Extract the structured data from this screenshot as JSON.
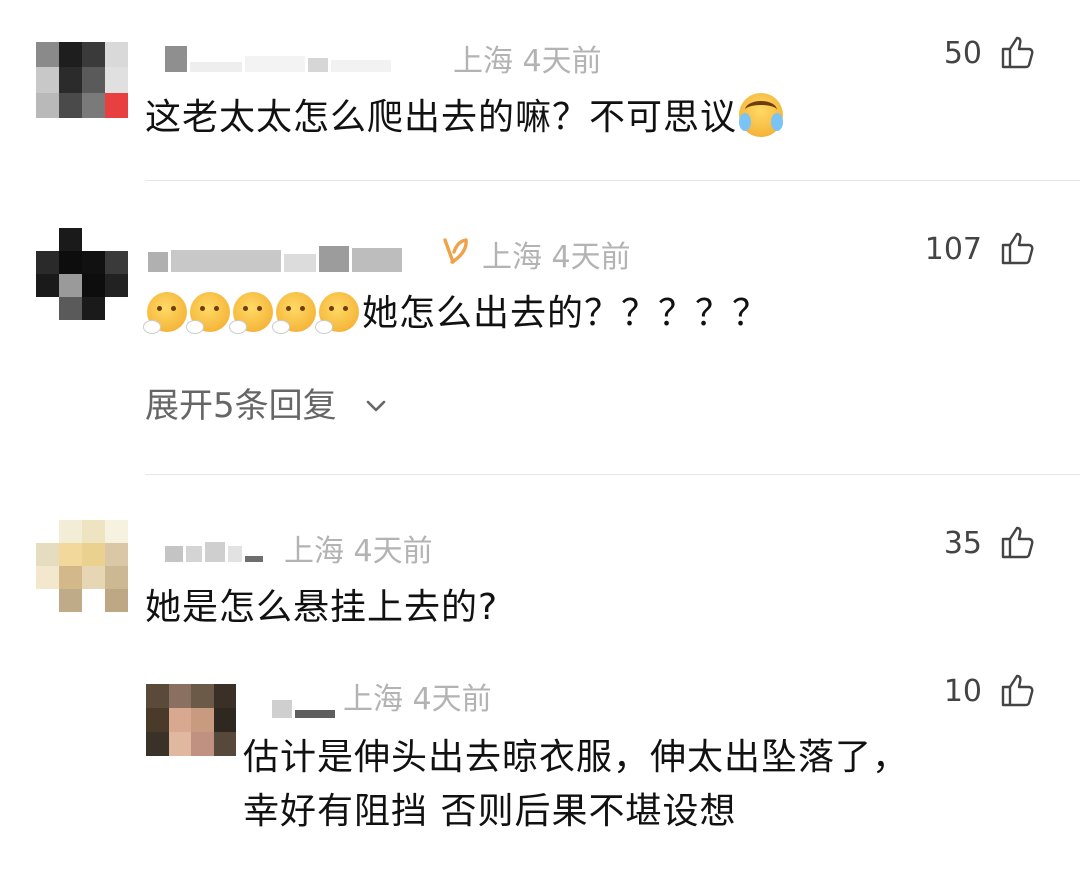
{
  "comments": [
    {
      "location": "上海",
      "time": "4天前",
      "likes": "50",
      "text": "这老太太怎么爬出去的嘛？不可思议",
      "emoji_suffix": "laughing-crying-emoji"
    },
    {
      "location": "上海",
      "time": "4天前",
      "likes": "107",
      "emoji_prefix": [
        "sad-emoji",
        "sad-emoji",
        "sad-emoji",
        "sad-emoji",
        "sad-emoji"
      ],
      "text": "她怎么出去的？？？？？",
      "badge_icon": "vip-badge-icon",
      "expand_label": "展开5条回复"
    },
    {
      "location": "上海",
      "time": "4天前",
      "likes": "35",
      "text": "她是怎么悬挂上去的?",
      "reply": {
        "location": "上海",
        "time": "4天前",
        "likes": "10",
        "text_line1": "估计是伸头出去晾衣服，伸太出坠落了，",
        "text_line2": "幸好有阻挡 否则后果不堪设想"
      }
    }
  ],
  "colors": {
    "meta": "#b3b3b3",
    "text": "#111111",
    "divider": "#e6e6e6",
    "badge": "#f0a24b"
  }
}
